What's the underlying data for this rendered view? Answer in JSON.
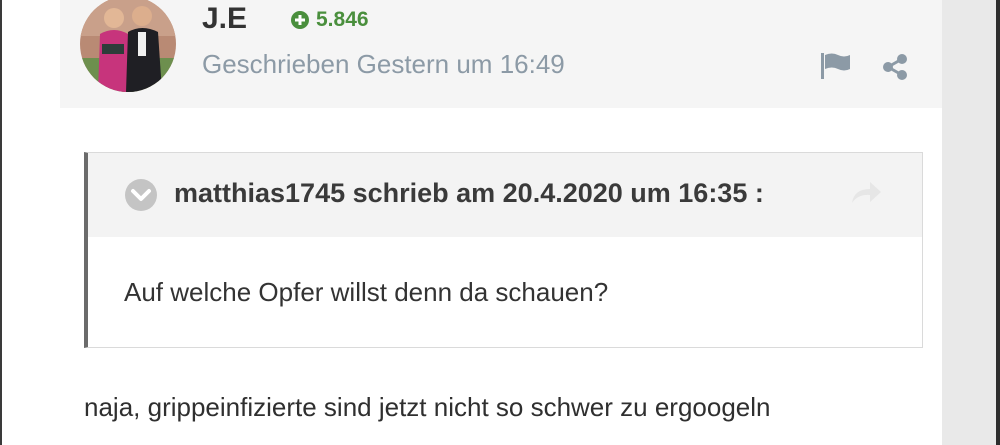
{
  "post": {
    "author": {
      "name": "J.E",
      "reputation": "5.846",
      "avatar_icon": "avatar-photo"
    },
    "timestamp": "Geschrieben Gestern um 16:49",
    "actions": {
      "report_icon": "flag-icon",
      "share_icon": "share-icon"
    },
    "quote": {
      "citation": "matthias1745 schrieb am 20.4.2020 um 16:35 :",
      "text": "Auf welche Opfer willst denn da schauen?",
      "toggle_icon": "chevron-down-icon",
      "link_icon": "reply-arrow-icon"
    },
    "content": "naja, grippeinfizierte sind jetzt nicht so schwer zu ergoogeln"
  },
  "colors": {
    "header_bg": "#f5f5f5",
    "reputation_green": "#4a8f3d",
    "meta_gray": "#8c9aa6",
    "quote_border": "#6b6b6b",
    "quote_header_bg": "#f3f3f3",
    "page_bg": "#e9e9e9"
  }
}
